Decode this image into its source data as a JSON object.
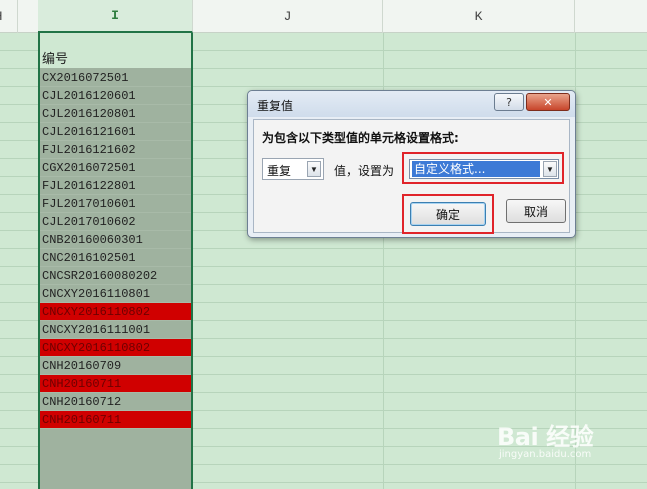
{
  "columns": [
    "H",
    "I",
    "J",
    "K"
  ],
  "column_i": {
    "header_cell": "编号",
    "cells": [
      {
        "value": "CX2016072501",
        "duplicate": false
      },
      {
        "value": "CJL2016120601",
        "duplicate": false
      },
      {
        "value": "CJL2016120801",
        "duplicate": false
      },
      {
        "value": "CJL2016121601",
        "duplicate": false
      },
      {
        "value": "FJL2016121602",
        "duplicate": false
      },
      {
        "value": "CGX2016072501",
        "duplicate": false
      },
      {
        "value": "FJL2016122801",
        "duplicate": false
      },
      {
        "value": "FJL2017010601",
        "duplicate": false
      },
      {
        "value": "CJL2017010602",
        "duplicate": false
      },
      {
        "value": "CNB20160060301",
        "duplicate": false
      },
      {
        "value": "CNC2016102501",
        "duplicate": false
      },
      {
        "value": "CNCSR20160080202",
        "duplicate": false
      },
      {
        "value": "CNCXY2016110801",
        "duplicate": false
      },
      {
        "value": "CNCXY2016110802",
        "duplicate": true
      },
      {
        "value": "CNCXY2016111001",
        "duplicate": false
      },
      {
        "value": "CNCXY2016110802",
        "duplicate": true
      },
      {
        "value": "CNH20160709",
        "duplicate": false
      },
      {
        "value": "CNH20160711",
        "duplicate": true
      },
      {
        "value": "CNH20160712",
        "duplicate": false
      },
      {
        "value": "CNH20160711",
        "duplicate": true
      }
    ]
  },
  "dialog": {
    "title": "重复值",
    "help_button": "?",
    "close_button": "✕",
    "prompt": "为包含以下类型值的单元格设置格式:",
    "type_select": "重复",
    "mid_label": "值，设置为",
    "format_select": "自定义格式...",
    "ok_button": "确定",
    "cancel_button": "取消"
  },
  "colors": {
    "duplicate_fill": "#d00000",
    "highlight_box": "#e0242a",
    "selected_column": "#9fb29f"
  },
  "watermark": {
    "logo": "Bai 经验",
    "url": "jingyan.baidu.com"
  }
}
